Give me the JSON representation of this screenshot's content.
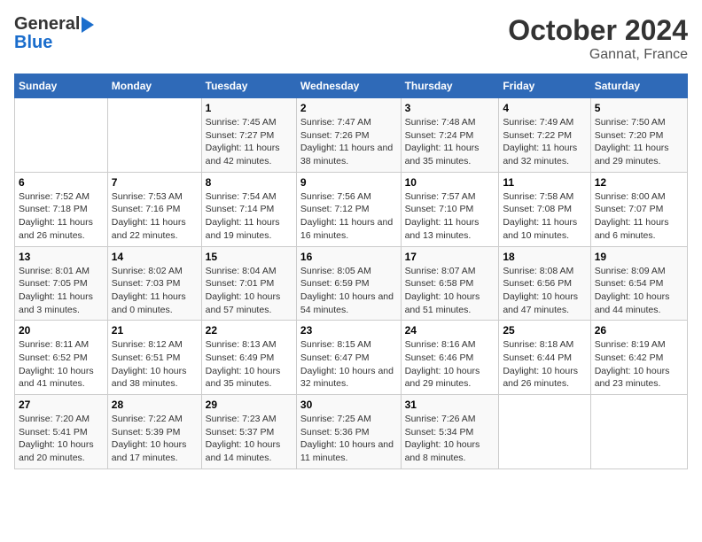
{
  "logo": {
    "line1": "General",
    "line2": "Blue"
  },
  "title": "October 2024",
  "subtitle": "Gannat, France",
  "days_header": [
    "Sunday",
    "Monday",
    "Tuesday",
    "Wednesday",
    "Thursday",
    "Friday",
    "Saturday"
  ],
  "weeks": [
    [
      {
        "day": "",
        "sunrise": "",
        "sunset": "",
        "daylight": ""
      },
      {
        "day": "",
        "sunrise": "",
        "sunset": "",
        "daylight": ""
      },
      {
        "day": "1",
        "sunrise": "Sunrise: 7:45 AM",
        "sunset": "Sunset: 7:27 PM",
        "daylight": "Daylight: 11 hours and 42 minutes."
      },
      {
        "day": "2",
        "sunrise": "Sunrise: 7:47 AM",
        "sunset": "Sunset: 7:26 PM",
        "daylight": "Daylight: 11 hours and 38 minutes."
      },
      {
        "day": "3",
        "sunrise": "Sunrise: 7:48 AM",
        "sunset": "Sunset: 7:24 PM",
        "daylight": "Daylight: 11 hours and 35 minutes."
      },
      {
        "day": "4",
        "sunrise": "Sunrise: 7:49 AM",
        "sunset": "Sunset: 7:22 PM",
        "daylight": "Daylight: 11 hours and 32 minutes."
      },
      {
        "day": "5",
        "sunrise": "Sunrise: 7:50 AM",
        "sunset": "Sunset: 7:20 PM",
        "daylight": "Daylight: 11 hours and 29 minutes."
      }
    ],
    [
      {
        "day": "6",
        "sunrise": "Sunrise: 7:52 AM",
        "sunset": "Sunset: 7:18 PM",
        "daylight": "Daylight: 11 hours and 26 minutes."
      },
      {
        "day": "7",
        "sunrise": "Sunrise: 7:53 AM",
        "sunset": "Sunset: 7:16 PM",
        "daylight": "Daylight: 11 hours and 22 minutes."
      },
      {
        "day": "8",
        "sunrise": "Sunrise: 7:54 AM",
        "sunset": "Sunset: 7:14 PM",
        "daylight": "Daylight: 11 hours and 19 minutes."
      },
      {
        "day": "9",
        "sunrise": "Sunrise: 7:56 AM",
        "sunset": "Sunset: 7:12 PM",
        "daylight": "Daylight: 11 hours and 16 minutes."
      },
      {
        "day": "10",
        "sunrise": "Sunrise: 7:57 AM",
        "sunset": "Sunset: 7:10 PM",
        "daylight": "Daylight: 11 hours and 13 minutes."
      },
      {
        "day": "11",
        "sunrise": "Sunrise: 7:58 AM",
        "sunset": "Sunset: 7:08 PM",
        "daylight": "Daylight: 11 hours and 10 minutes."
      },
      {
        "day": "12",
        "sunrise": "Sunrise: 8:00 AM",
        "sunset": "Sunset: 7:07 PM",
        "daylight": "Daylight: 11 hours and 6 minutes."
      }
    ],
    [
      {
        "day": "13",
        "sunrise": "Sunrise: 8:01 AM",
        "sunset": "Sunset: 7:05 PM",
        "daylight": "Daylight: 11 hours and 3 minutes."
      },
      {
        "day": "14",
        "sunrise": "Sunrise: 8:02 AM",
        "sunset": "Sunset: 7:03 PM",
        "daylight": "Daylight: 11 hours and 0 minutes."
      },
      {
        "day": "15",
        "sunrise": "Sunrise: 8:04 AM",
        "sunset": "Sunset: 7:01 PM",
        "daylight": "Daylight: 10 hours and 57 minutes."
      },
      {
        "day": "16",
        "sunrise": "Sunrise: 8:05 AM",
        "sunset": "Sunset: 6:59 PM",
        "daylight": "Daylight: 10 hours and 54 minutes."
      },
      {
        "day": "17",
        "sunrise": "Sunrise: 8:07 AM",
        "sunset": "Sunset: 6:58 PM",
        "daylight": "Daylight: 10 hours and 51 minutes."
      },
      {
        "day": "18",
        "sunrise": "Sunrise: 8:08 AM",
        "sunset": "Sunset: 6:56 PM",
        "daylight": "Daylight: 10 hours and 47 minutes."
      },
      {
        "day": "19",
        "sunrise": "Sunrise: 8:09 AM",
        "sunset": "Sunset: 6:54 PM",
        "daylight": "Daylight: 10 hours and 44 minutes."
      }
    ],
    [
      {
        "day": "20",
        "sunrise": "Sunrise: 8:11 AM",
        "sunset": "Sunset: 6:52 PM",
        "daylight": "Daylight: 10 hours and 41 minutes."
      },
      {
        "day": "21",
        "sunrise": "Sunrise: 8:12 AM",
        "sunset": "Sunset: 6:51 PM",
        "daylight": "Daylight: 10 hours and 38 minutes."
      },
      {
        "day": "22",
        "sunrise": "Sunrise: 8:13 AM",
        "sunset": "Sunset: 6:49 PM",
        "daylight": "Daylight: 10 hours and 35 minutes."
      },
      {
        "day": "23",
        "sunrise": "Sunrise: 8:15 AM",
        "sunset": "Sunset: 6:47 PM",
        "daylight": "Daylight: 10 hours and 32 minutes."
      },
      {
        "day": "24",
        "sunrise": "Sunrise: 8:16 AM",
        "sunset": "Sunset: 6:46 PM",
        "daylight": "Daylight: 10 hours and 29 minutes."
      },
      {
        "day": "25",
        "sunrise": "Sunrise: 8:18 AM",
        "sunset": "Sunset: 6:44 PM",
        "daylight": "Daylight: 10 hours and 26 minutes."
      },
      {
        "day": "26",
        "sunrise": "Sunrise: 8:19 AM",
        "sunset": "Sunset: 6:42 PM",
        "daylight": "Daylight: 10 hours and 23 minutes."
      }
    ],
    [
      {
        "day": "27",
        "sunrise": "Sunrise: 7:20 AM",
        "sunset": "Sunset: 5:41 PM",
        "daylight": "Daylight: 10 hours and 20 minutes."
      },
      {
        "day": "28",
        "sunrise": "Sunrise: 7:22 AM",
        "sunset": "Sunset: 5:39 PM",
        "daylight": "Daylight: 10 hours and 17 minutes."
      },
      {
        "day": "29",
        "sunrise": "Sunrise: 7:23 AM",
        "sunset": "Sunset: 5:37 PM",
        "daylight": "Daylight: 10 hours and 14 minutes."
      },
      {
        "day": "30",
        "sunrise": "Sunrise: 7:25 AM",
        "sunset": "Sunset: 5:36 PM",
        "daylight": "Daylight: 10 hours and 11 minutes."
      },
      {
        "day": "31",
        "sunrise": "Sunrise: 7:26 AM",
        "sunset": "Sunset: 5:34 PM",
        "daylight": "Daylight: 10 hours and 8 minutes."
      },
      {
        "day": "",
        "sunrise": "",
        "sunset": "",
        "daylight": ""
      },
      {
        "day": "",
        "sunrise": "",
        "sunset": "",
        "daylight": ""
      }
    ]
  ]
}
